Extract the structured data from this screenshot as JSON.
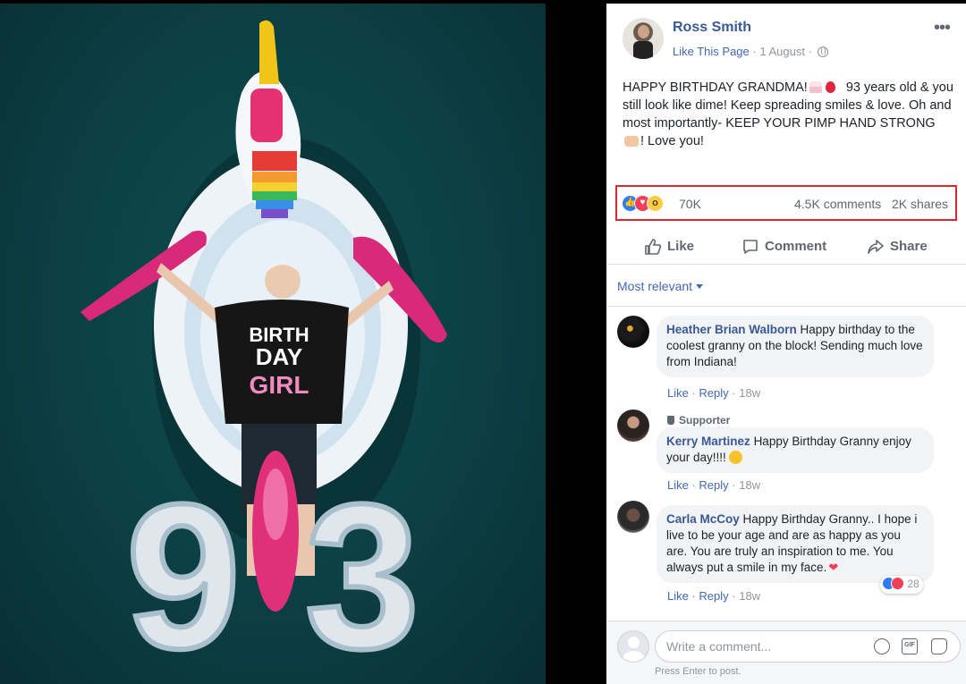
{
  "post": {
    "page_name": "Ross Smith",
    "like_page": "Like This Page",
    "separator": "·",
    "date": "1 August",
    "text_part1": "HAPPY BIRTHDAY GRANDMA!",
    "text_part2": " 93 years old & you still look like dime! Keep spreading smiles & love. Oh and most importantly- KEEP YOUR PIMP HAND STRONG ",
    "text_part3": "! Love you!"
  },
  "stats": {
    "reactions_count": "70K",
    "comments": "4.5K comments",
    "shares": "2K shares"
  },
  "actions": {
    "like": "Like",
    "comment": "Comment",
    "share": "Share"
  },
  "sort_label": "Most relevant",
  "comments": [
    {
      "author": "Heather Brian Walborn",
      "text": "Happy birthday to the coolest granny on the block! Sending much love from Indiana!",
      "like": "Like",
      "reply": "Reply",
      "time": "18w"
    },
    {
      "badge": "Supporter",
      "author": "Kerry Martinez",
      "text": "Happy Birthday Granny enjoy your day!!!!",
      "like": "Like",
      "reply": "Reply",
      "time": "18w"
    },
    {
      "author": "Carla McCoy",
      "text": "Happy Birthday Granny.. I hope i live to be your age and are as happy as you are. You are truly an inspiration to me. You always put a smile in my face.",
      "like": "Like",
      "reply": "Reply",
      "time": "18w",
      "reaction_count": "28"
    }
  ],
  "compose": {
    "placeholder": "Write a comment...",
    "hint": "Press Enter to post.",
    "gif": "GIF"
  },
  "photo": {
    "shirt_line1": "BIRTH",
    "shirt_line2": "DAY",
    "shirt_line3": "GIRL",
    "balloon_digit1": "9",
    "balloon_digit2": "3"
  },
  "colors": {
    "link": "#385898",
    "accent": "#4267b2",
    "highlight_box": "#e0242a",
    "water": "#0c3f44"
  }
}
